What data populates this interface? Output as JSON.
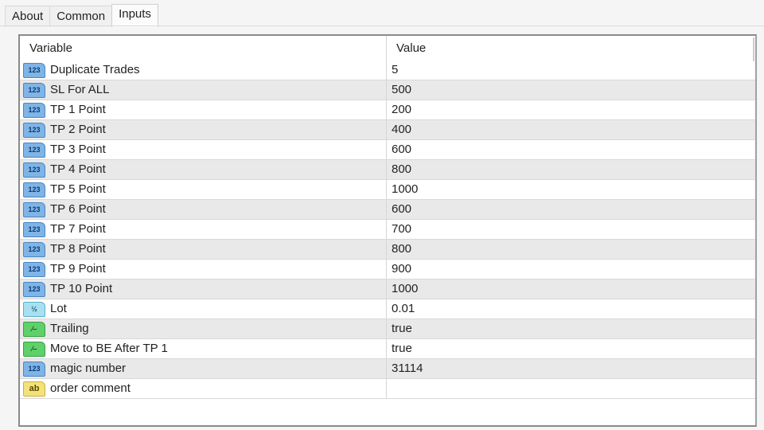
{
  "tabs": [
    {
      "label": "About"
    },
    {
      "label": "Common"
    },
    {
      "label": "Inputs",
      "active": true
    }
  ],
  "table": {
    "headers": {
      "variable": "Variable",
      "value": "Value"
    },
    "rows": [
      {
        "icon": "int",
        "icon_text": "123",
        "name": "Duplicate Trades",
        "value": "5"
      },
      {
        "icon": "int",
        "icon_text": "123",
        "name": "SL For ALL",
        "value": "500"
      },
      {
        "icon": "int",
        "icon_text": "123",
        "name": "TP 1 Point",
        "value": "200"
      },
      {
        "icon": "int",
        "icon_text": "123",
        "name": "TP 2 Point",
        "value": "400"
      },
      {
        "icon": "int",
        "icon_text": "123",
        "name": "TP 3 Point",
        "value": "600"
      },
      {
        "icon": "int",
        "icon_text": "123",
        "name": "TP 4 Point",
        "value": "800"
      },
      {
        "icon": "int",
        "icon_text": "123",
        "name": "TP 5 Point",
        "value": "1000"
      },
      {
        "icon": "int",
        "icon_text": "123",
        "name": "TP 6 Point",
        "value": "600"
      },
      {
        "icon": "int",
        "icon_text": "123",
        "name": "TP 7 Point",
        "value": "700"
      },
      {
        "icon": "int",
        "icon_text": "123",
        "name": "TP 8 Point",
        "value": "800"
      },
      {
        "icon": "int",
        "icon_text": "123",
        "name": "TP 9 Point",
        "value": "900"
      },
      {
        "icon": "int",
        "icon_text": "123",
        "name": "TP 10 Point",
        "value": "1000"
      },
      {
        "icon": "dbl",
        "icon_text": "½",
        "name": "Lot",
        "value": "0.01"
      },
      {
        "icon": "bool",
        "icon_text": "⁄‒",
        "name": "Trailing",
        "value": "true"
      },
      {
        "icon": "bool",
        "icon_text": "⁄‒",
        "name": "Move to BE After TP 1",
        "value": "true"
      },
      {
        "icon": "int",
        "icon_text": "123",
        "name": "magic number",
        "value": "31114"
      },
      {
        "icon": "str",
        "icon_text": "ab",
        "name": "order comment",
        "value": ""
      }
    ]
  }
}
